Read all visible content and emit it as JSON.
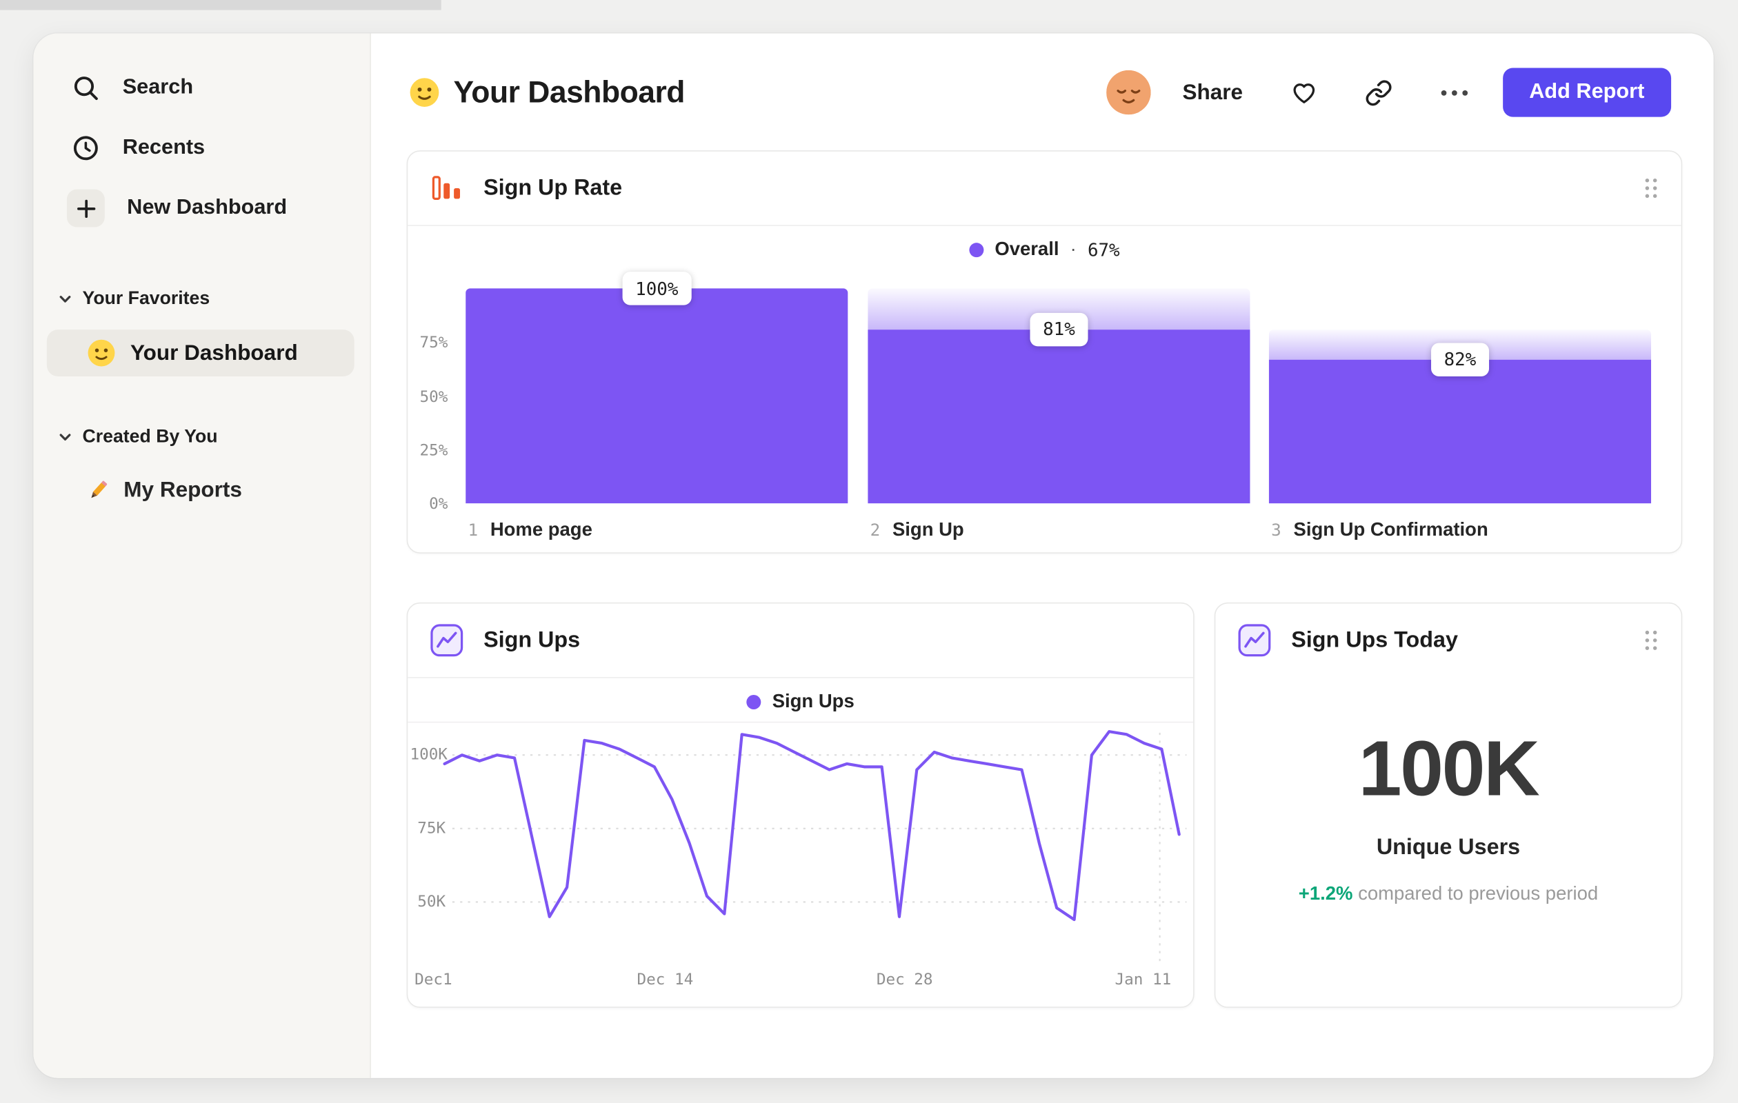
{
  "colors": {
    "accent_purple": "#7d55f3",
    "button_purple": "#5948f0",
    "positive_green": "#0ca678",
    "funnel_icon_orange": "#ee5a2b"
  },
  "sidebar": {
    "nav": [
      {
        "label": "Search",
        "icon": "search-icon"
      },
      {
        "label": "Recents",
        "icon": "clock-icon"
      },
      {
        "label": "New Dashboard",
        "icon": "plus-icon"
      }
    ],
    "sections": [
      {
        "title": "Your Favorites",
        "items": [
          {
            "label": "Your Dashboard",
            "icon": "smiley-emoji",
            "selected": true
          }
        ]
      },
      {
        "title": "Created By You",
        "items": [
          {
            "label": "My Reports",
            "icon": "pencil-emoji",
            "selected": false
          }
        ]
      }
    ]
  },
  "header": {
    "title": "Your Dashboard",
    "share_label": "Share",
    "add_report_label": "Add Report"
  },
  "cards": {
    "funnel": {
      "title": "Sign Up Rate",
      "legend_label": "Overall",
      "legend_separator": "·",
      "legend_value": "67%"
    },
    "line": {
      "title": "Sign Ups",
      "legend_label": "Sign Ups"
    },
    "metric": {
      "title": "Sign Ups Today",
      "value": "100K",
      "label": "Unique Users",
      "delta": "+1.2%",
      "delta_text": "compared to previous period"
    }
  },
  "chart_data": [
    {
      "type": "bar",
      "subtype": "funnel",
      "title": "Sign Up Rate",
      "legend": "Overall · 67%",
      "overall_conversion": "67%",
      "categories": [
        "Home page",
        "Sign Up",
        "Sign Up Confirmation"
      ],
      "steps": [
        {
          "num": "1",
          "name": "Home page",
          "pct_label": "100%",
          "overall_pct": 100,
          "from_previous_pct": 100
        },
        {
          "num": "2",
          "name": "Sign Up",
          "pct_label": "81%",
          "overall_pct": 81,
          "from_previous_pct": 81
        },
        {
          "num": "3",
          "name": "Sign Up Confirmation",
          "pct_label": "82%",
          "overall_pct": 67,
          "from_previous_pct": 82
        }
      ],
      "y_ticks": [
        {
          "label": "75%",
          "value": 75
        },
        {
          "label": "50%",
          "value": 50
        },
        {
          "label": "25%",
          "value": 25
        },
        {
          "label": "0%",
          "value": 0
        }
      ],
      "ylim": [
        0,
        100
      ],
      "bar_color": "#7d55f3",
      "legend_position": "top-center"
    },
    {
      "type": "line",
      "title": "Sign Ups",
      "legend": "Sign Ups",
      "unit": "thousands",
      "series": [
        {
          "name": "Sign Ups",
          "values": [
            97,
            100,
            98,
            100,
            99,
            72,
            45,
            55,
            105,
            104,
            102,
            99,
            96,
            85,
            70,
            52,
            46,
            107,
            106,
            104,
            101,
            98,
            95,
            97,
            96,
            96,
            45,
            95,
            101,
            99,
            98,
            97,
            96,
            95,
            70,
            48,
            44,
            100,
            108,
            107,
            104,
            102,
            73
          ]
        }
      ],
      "x_ticks": [
        "Dec1",
        "Dec 14",
        "Dec 28",
        "Jan 11"
      ],
      "y_ticks": [
        {
          "label": "100K",
          "value": 100
        },
        {
          "label": "75K",
          "value": 75
        },
        {
          "label": "50K",
          "value": 50
        }
      ],
      "ylim_thousands": [
        40,
        112
      ],
      "grid": "dotted",
      "line_color": "#7d55f3",
      "legend_position": "top-center"
    },
    {
      "type": "single_value",
      "title": "Sign Ups Today",
      "value": "100K",
      "label": "Unique Users",
      "delta_pct": "+1.2%",
      "comparison": "compared to previous period"
    }
  ]
}
